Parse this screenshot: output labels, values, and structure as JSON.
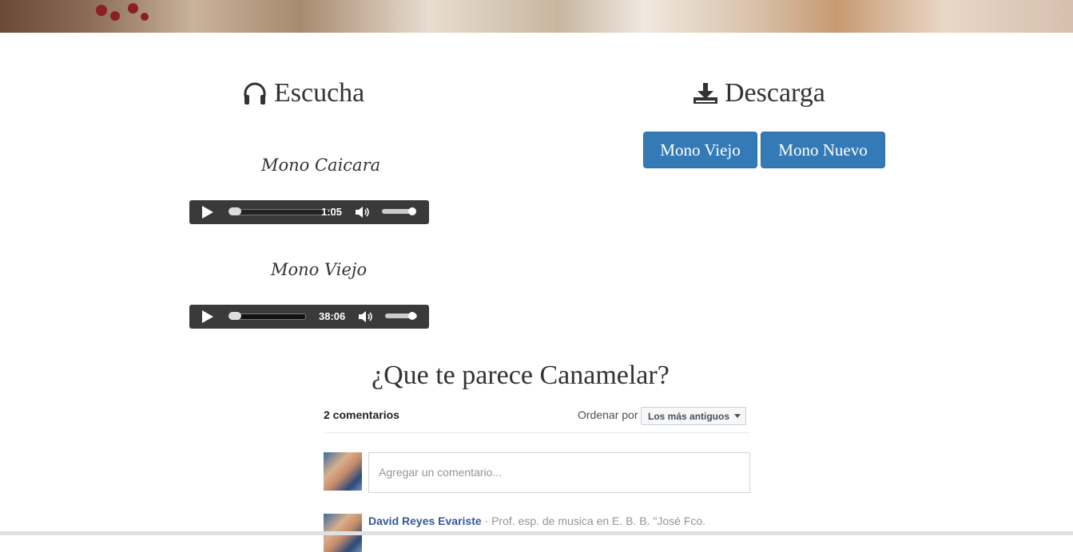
{
  "listen": {
    "title": "Escucha",
    "icon": "headphones-icon",
    "tracks": [
      {
        "title": "Mono Caicara",
        "time": "1:05",
        "progress": 0.0
      },
      {
        "title": "Mono Viejo",
        "time": "38:06",
        "progress": 0.0
      }
    ]
  },
  "download": {
    "title": "Descarga",
    "icon": "download-icon",
    "buttons": [
      "Mono Viejo",
      "Mono Nuevo"
    ]
  },
  "comments": {
    "heading": "¿Que te parece Canamelar?",
    "count_label": "2 comentarios",
    "order_label": "Ordenar por",
    "order_value": "Los más antiguos",
    "input_placeholder": "Agregar un comentario...",
    "first_comment": {
      "author": "David Reyes Evariste",
      "meta": " · Prof. esp. de musica en E. B. B. \"José Fco."
    }
  },
  "colors": {
    "button_bg": "#337ab7",
    "player_bg": "#3a3a3a",
    "link": "#365899"
  }
}
